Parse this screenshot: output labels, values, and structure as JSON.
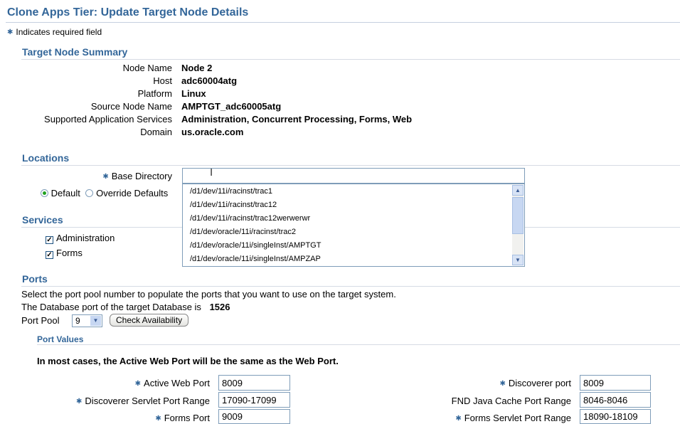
{
  "page": {
    "title": "Clone Apps Tier: Update Target Node Details",
    "required_note": "Indicates required field"
  },
  "summary": {
    "title": "Target Node Summary",
    "rows": [
      {
        "label": "Node Name",
        "value": "Node 2"
      },
      {
        "label": "Host",
        "value": "adc60004atg"
      },
      {
        "label": "Platform",
        "value": "Linux"
      },
      {
        "label": "Source Node Name",
        "value": "AMPTGT_adc60005atg"
      },
      {
        "label": "Supported Application Services",
        "value": "Administration, Concurrent Processing, Forms, Web"
      },
      {
        "label": "Domain",
        "value": "us.oracle.com"
      }
    ]
  },
  "locations": {
    "title": "Locations",
    "base_dir_label": "Base Directory",
    "base_dir_value": "",
    "radio_default": "Default",
    "radio_override": "Override Defaults",
    "suggestions": [
      "/d1/dev/11i/racinst/trac1",
      "/d1/dev/11i/racinst/trac12",
      "/d1/dev/11i/racinst/trac12werwerwr",
      "/d1/dev/oracle/11i/racinst/trac2",
      "/d1/dev/oracle/11i/singleInst/AMPTGT",
      "/d1/dev/oracle/11i/singleInst/AMPZAP"
    ]
  },
  "services": {
    "title": "Services",
    "items": [
      "Administration",
      "Forms"
    ]
  },
  "ports": {
    "title": "Ports",
    "instruction": "Select the port pool number to populate the ports that you want to use on the target system.",
    "db_port_label": "The Database port of the target Database is",
    "db_port_value": "1526",
    "pool_label": "Port Pool",
    "pool_value": "9",
    "check_button": "Check Availability",
    "values_title": "Port Values",
    "note": "In most cases, the Active Web Port will be the same as the Web Port.",
    "fields": {
      "active_web_port": {
        "label": "Active Web Port",
        "value": "8009"
      },
      "discoverer_servlet_range": {
        "label": "Discoverer Servlet Port Range",
        "value": "17090-17099"
      },
      "forms_port": {
        "label": "Forms Port",
        "value": "9009"
      },
      "discoverer_port": {
        "label": "Discoverer port",
        "value": "8009"
      },
      "fnd_java_cache_range": {
        "label": "FND Java Cache Port Range",
        "value": "8046-8046"
      },
      "forms_servlet_range": {
        "label": "Forms Servlet Port Range",
        "value": "18090-18109"
      }
    }
  }
}
